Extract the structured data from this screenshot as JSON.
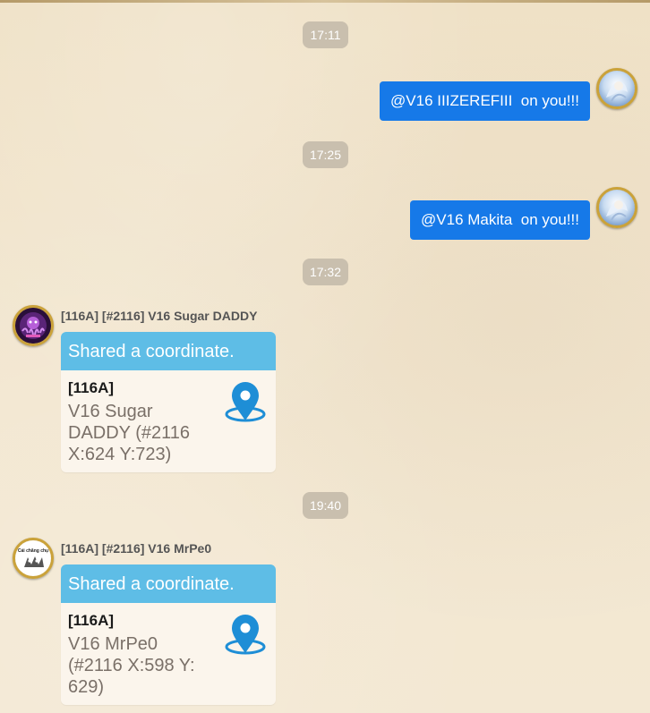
{
  "messages": [
    {
      "time": "17:11"
    },
    {
      "text": "@V16 IIIZEREFIII  on you!!!"
    },
    {
      "time": "17:25"
    },
    {
      "text": "@V16 Makita  on you!!!"
    },
    {
      "time": "17:32"
    },
    {
      "sender": "[116A] [#2116] V16 Sugar DADDY",
      "card": {
        "header": "Shared a coordinate.",
        "alliance": "[116A]",
        "place": "V16 Sugar DADDY (#2116 X:624 Y:723)"
      }
    },
    {
      "time": "19:40"
    },
    {
      "sender": "[116A] [#2116] V16 MrPe0",
      "card": {
        "header": "Shared a coordinate.",
        "alliance": "[116A]",
        "place": "V16 MrPe0 (#2116 X:598 Y: 629)"
      }
    }
  ],
  "avatar2": {
    "text": "Cái chăng chụ"
  },
  "colors": {
    "outgoing_bubble": "#1679e8",
    "card_header": "#5ebde6",
    "time_chip": "#c9bfae",
    "avatar_ring": "#caa23a"
  },
  "icons": [
    "location-pin-icon",
    "avatar-icon"
  ]
}
